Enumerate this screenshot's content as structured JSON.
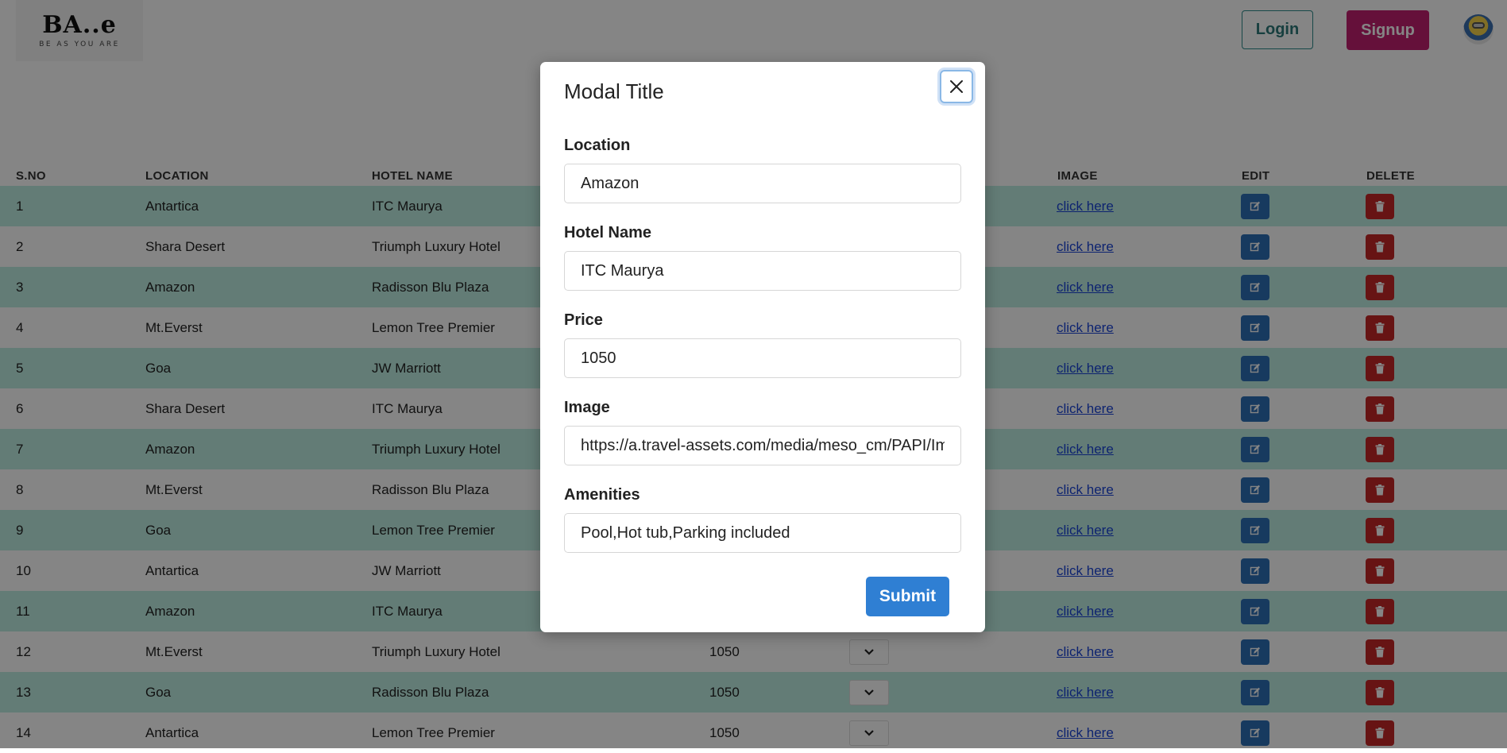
{
  "header": {
    "logo_text": "BA..e",
    "logo_tagline": "BE AS YOU ARE",
    "login_label": "Login",
    "signup_label": "Signup",
    "avatar_icon": "minion-avatar-icon"
  },
  "table": {
    "columns": [
      "S.NO",
      "LOCATION",
      "HOTEL NAME",
      "IMAGE",
      "EDIT",
      "DELETE"
    ],
    "link_text": "click here",
    "rows": [
      {
        "sno": "1",
        "location": "Antartica",
        "hotel": "ITC Maurya",
        "price": ""
      },
      {
        "sno": "2",
        "location": "Shara Desert",
        "hotel": "Triumph Luxury Hotel",
        "price": ""
      },
      {
        "sno": "3",
        "location": "Amazon",
        "hotel": "Radisson Blu Plaza",
        "price": ""
      },
      {
        "sno": "4",
        "location": "Mt.Everst",
        "hotel": "Lemon Tree Premier",
        "price": ""
      },
      {
        "sno": "5",
        "location": "Goa",
        "hotel": "JW Marriott",
        "price": ""
      },
      {
        "sno": "6",
        "location": "Shara Desert",
        "hotel": "ITC Maurya",
        "price": ""
      },
      {
        "sno": "7",
        "location": "Amazon",
        "hotel": "Triumph Luxury Hotel",
        "price": ""
      },
      {
        "sno": "8",
        "location": "Mt.Everst",
        "hotel": "Radisson Blu Plaza",
        "price": ""
      },
      {
        "sno": "9",
        "location": "Goa",
        "hotel": "Lemon Tree Premier",
        "price": ""
      },
      {
        "sno": "10",
        "location": "Antartica",
        "hotel": "JW Marriott",
        "price": ""
      },
      {
        "sno": "11",
        "location": "Amazon",
        "hotel": "ITC Maurya",
        "price": ""
      },
      {
        "sno": "12",
        "location": "Mt.Everst",
        "hotel": "Triumph Luxury Hotel",
        "price": "1050"
      },
      {
        "sno": "13",
        "location": "Goa",
        "hotel": "Radisson Blu Plaza",
        "price": "1050"
      },
      {
        "sno": "14",
        "location": "Antartica",
        "hotel": "Lemon Tree Premier",
        "price": "1050"
      }
    ]
  },
  "modal": {
    "title": "Modal Title",
    "close_icon": "close-icon",
    "location_label": "Location",
    "location_value": "Amazon",
    "hotel_label": "Hotel Name",
    "hotel_value": "ITC Maurya",
    "price_label": "Price",
    "price_value": "1050",
    "image_label": "Image",
    "image_value": "https://a.travel-assets.com/media/meso_cm/PAPI/Im",
    "amenities_label": "Amenities",
    "amenities_value": "Pool,Hot tub,Parking included",
    "submit_label": "Submit"
  },
  "colors": {
    "row_alt": "#bfeee3",
    "login_border": "#2c8a8a",
    "signup_bg": "#c2206f",
    "edit_bg": "#2d6fb7",
    "delete_bg": "#c62828",
    "submit_bg": "#2f7fd3",
    "overlay": "rgba(0,0,0,0.48)"
  }
}
